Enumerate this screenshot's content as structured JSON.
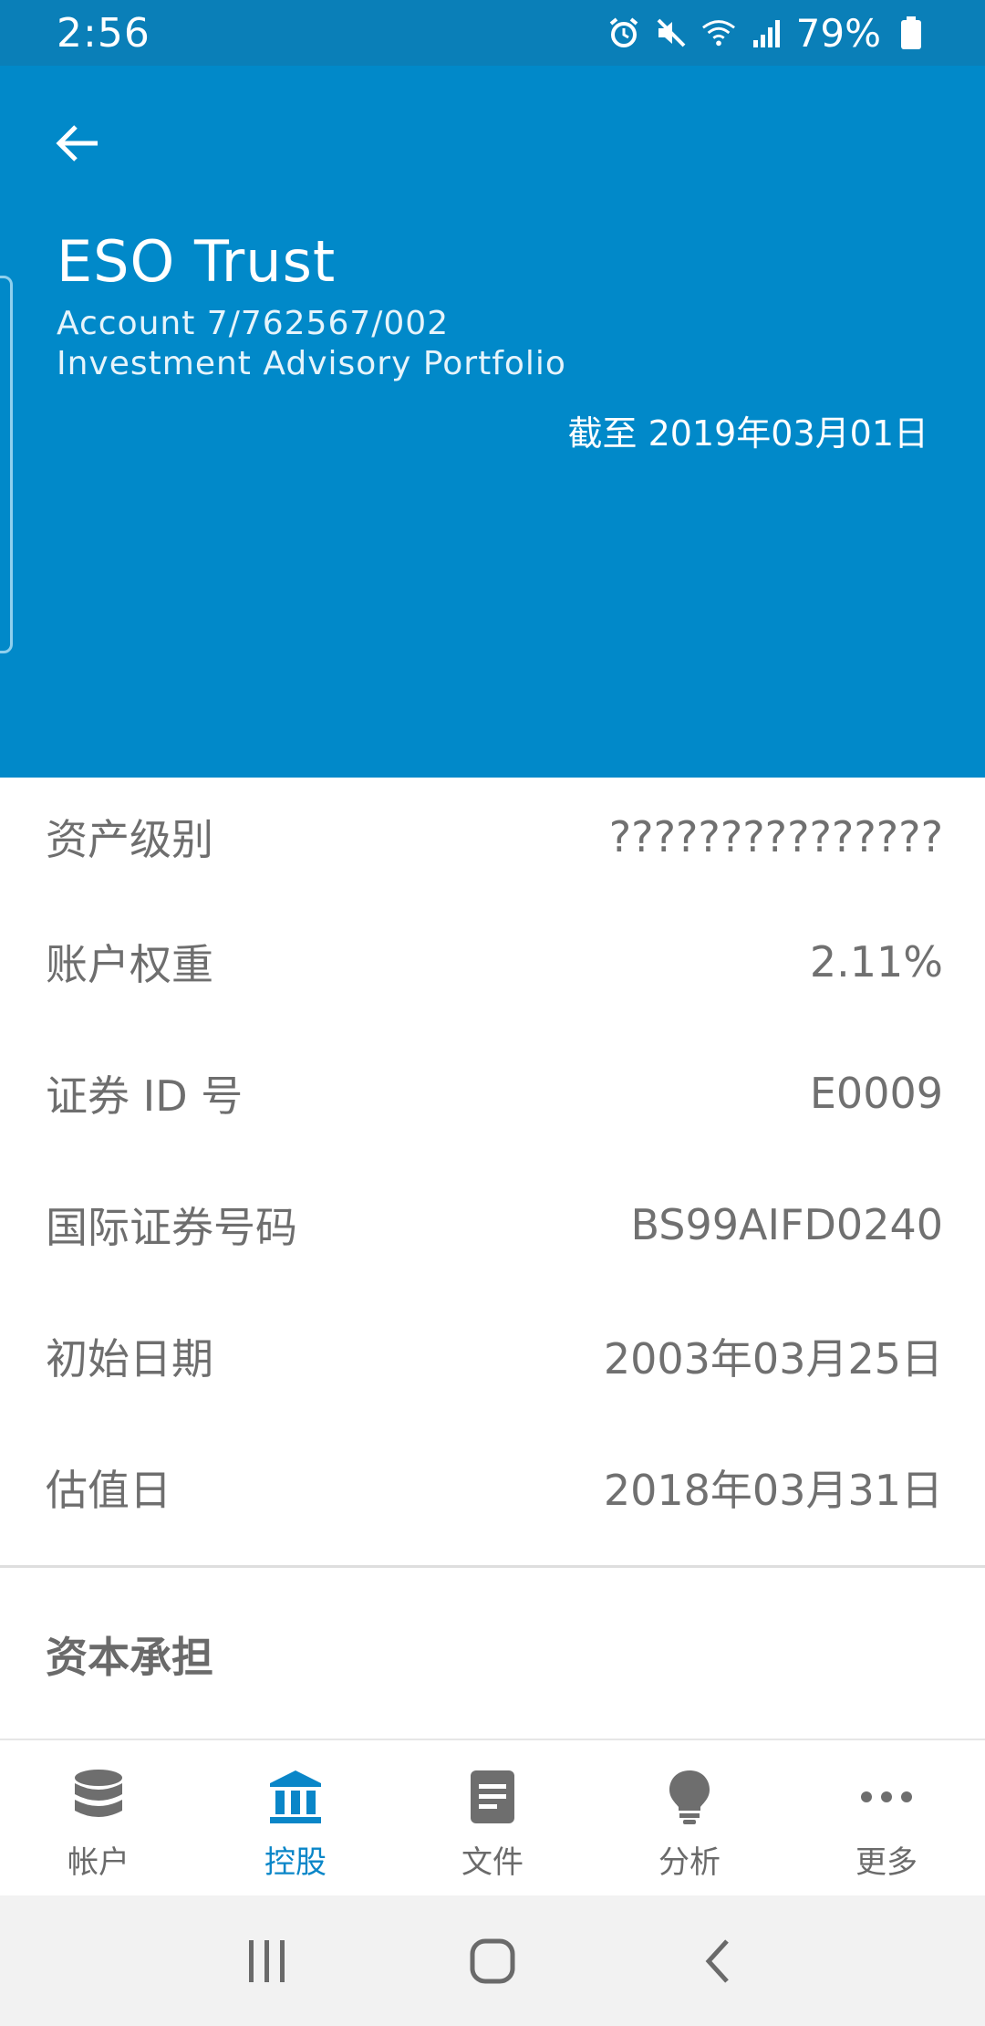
{
  "status_bar": {
    "time": "2:56",
    "battery": "79%",
    "icons": [
      "alarm-icon",
      "mute-icon",
      "wifi-icon",
      "signal-icon",
      "battery-icon"
    ]
  },
  "header": {
    "account_name": "ESO Trust",
    "account_number": "Account 7/762567/002",
    "account_type": "Investment Advisory Portfolio",
    "as_of": "截至 2019年03月01日",
    "background_color": "#0189c9"
  },
  "details": [
    {
      "label": "资产级别",
      "value": "???????????????"
    },
    {
      "label": "账户权重",
      "value": "2.11%"
    },
    {
      "label": "证券 ID 号",
      "value": "E0009"
    },
    {
      "label": "国际证券号码",
      "value": "BS99AIFD0240"
    },
    {
      "label": "初始日期",
      "value": "2003年03月25日"
    },
    {
      "label": "估值日",
      "value": "2018年03月31日"
    }
  ],
  "section": {
    "title": "资本承担"
  },
  "bottom_nav": {
    "active_color": "#0a86c8",
    "items": [
      {
        "label": "帐户",
        "icon": "database-icon",
        "active": false
      },
      {
        "label": "控股",
        "icon": "bank-icon",
        "active": true
      },
      {
        "label": "文件",
        "icon": "document-icon",
        "active": false
      },
      {
        "label": "分析",
        "icon": "lightbulb-icon",
        "active": false
      },
      {
        "label": "更多",
        "icon": "more-icon",
        "active": false
      }
    ]
  },
  "system_nav": {
    "buttons": [
      "recents-icon",
      "home-icon",
      "back-icon"
    ]
  }
}
